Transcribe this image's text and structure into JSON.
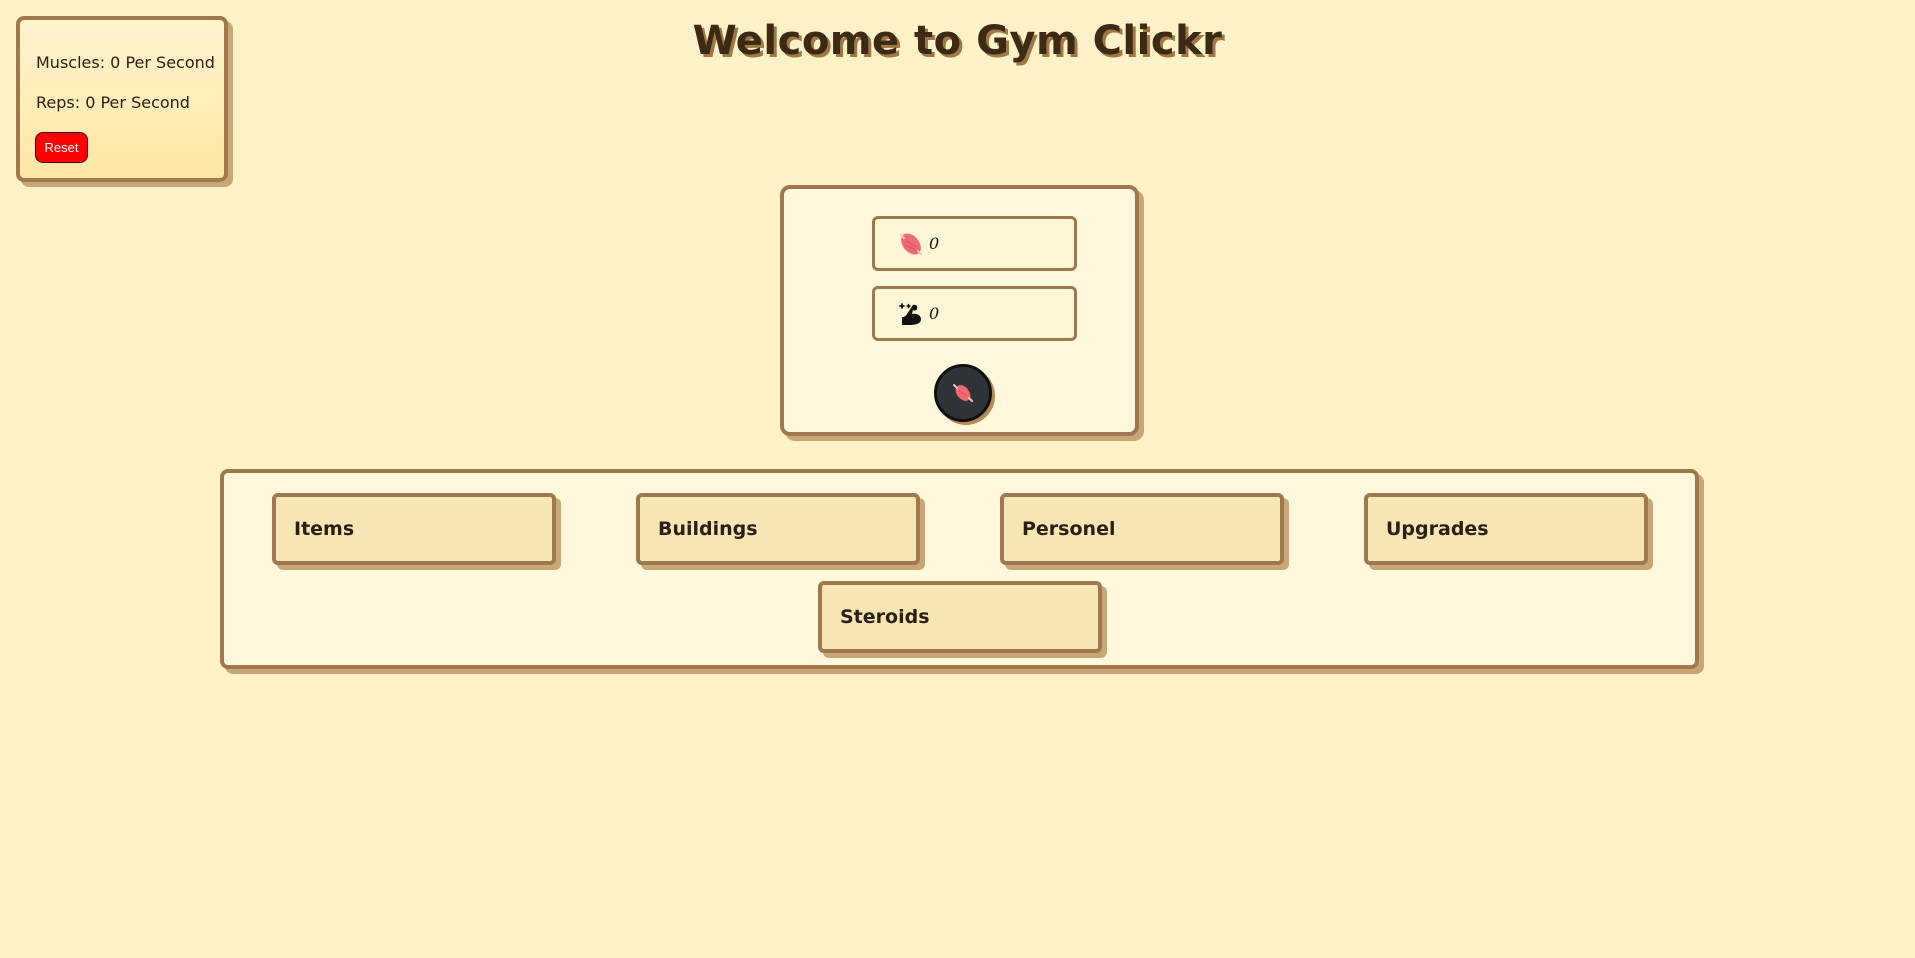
{
  "stats": {
    "muscles_per_second": "Muscles: 0 Per Second",
    "reps_per_second": "Reps: 0 Per Second",
    "reset_label": "Reset"
  },
  "title": "Welcome to Gym Clickr",
  "counters": {
    "muscles": {
      "value": "0",
      "icon": "muscle-icon"
    },
    "reps": {
      "value": "0",
      "icon": "flexed-arm-icon"
    }
  },
  "click_button": {
    "icon": "muscle-icon"
  },
  "shop": {
    "tabs": [
      {
        "label": "Items"
      },
      {
        "label": "Buildings"
      },
      {
        "label": "Personel"
      },
      {
        "label": "Upgrades"
      },
      {
        "label": "Steroids"
      }
    ]
  },
  "colors": {
    "background": "#fef3c7",
    "panel_border": "#a0784e",
    "reset_button": "#ff0000",
    "click_button": "#2f3438",
    "muscle": "#ef6b73"
  }
}
